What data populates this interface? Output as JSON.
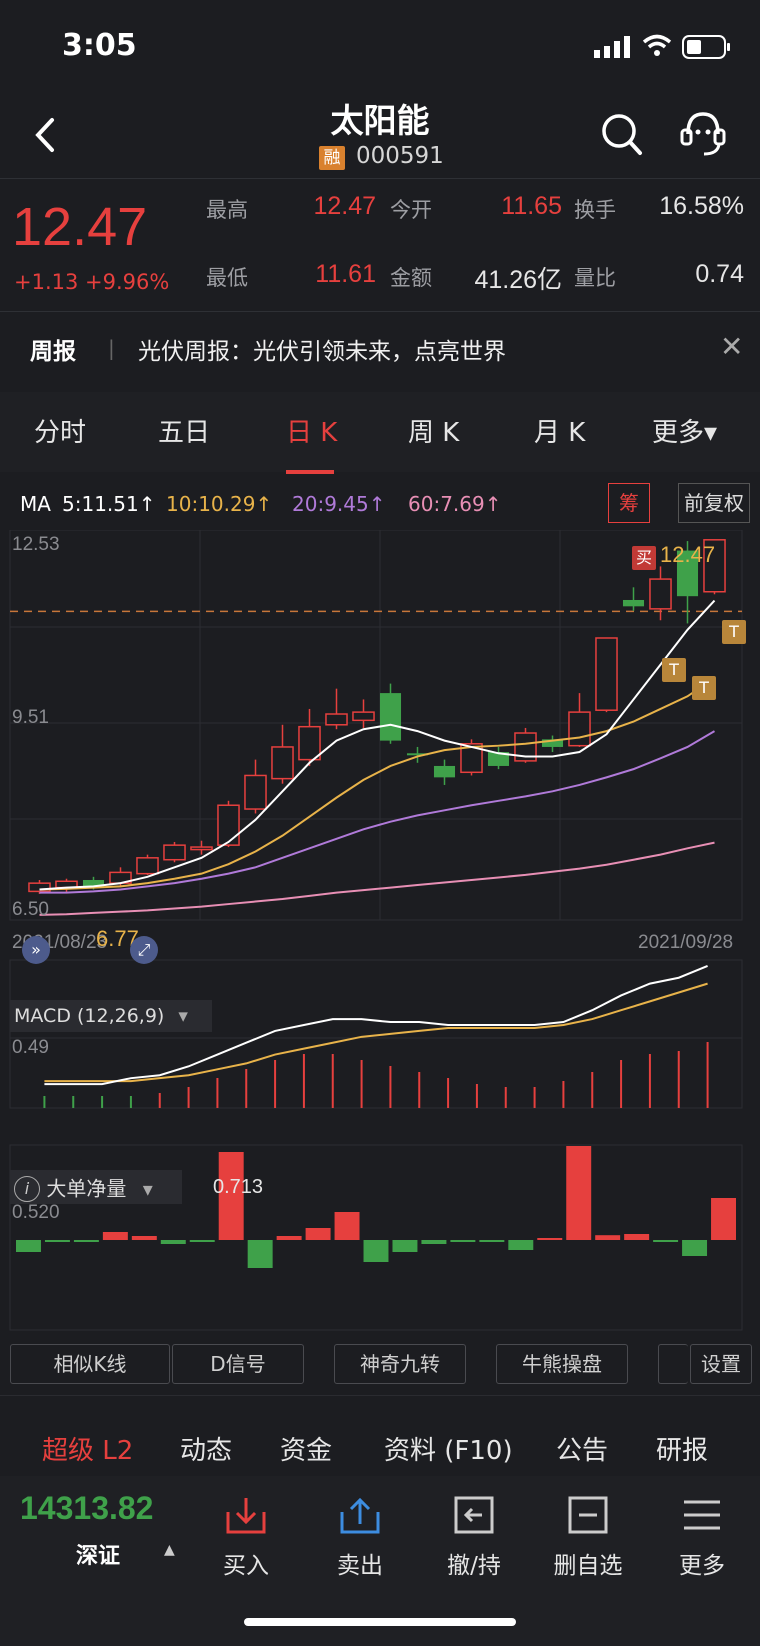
{
  "status_bar": {
    "time": "3:05"
  },
  "header": {
    "title": "太阳能",
    "badge": "融",
    "code": "000591"
  },
  "quote": {
    "price": "12.47",
    "change": "+1.13 +9.96%",
    "high_label": "最高",
    "high": "12.47",
    "open_label": "今开",
    "open": "11.65",
    "turnover_label": "换手",
    "turnover": "16.58%",
    "low_label": "最低",
    "low": "11.61",
    "amount_label": "金额",
    "amount": "41.26亿",
    "volume_ratio_label": "量比",
    "volume_ratio": "0.74"
  },
  "news": {
    "tag": "周报",
    "separator": "|",
    "text": "光伏周报：光伏引领未来，点亮世界",
    "close": "✕"
  },
  "chart_tabs": [
    "分时",
    "五日",
    "日 K",
    "周 K",
    "月 K",
    "更多▾"
  ],
  "ma": {
    "label": "MA",
    "ma5": "5:11.51↑",
    "ma10": "10:10.29↑",
    "ma20": "20:9.45↑",
    "ma60": "60:7.69↑"
  },
  "chart_buttons": {
    "chip": "筹",
    "adjust": "前复权"
  },
  "chart_labels": {
    "y_high": "12.53",
    "y_mid": "9.51",
    "y_low": "6.50",
    "date_start": "2021/08/23",
    "date_end": "2021/09/28",
    "buy_marker": "买",
    "last_marker": "12.47",
    "low_marker": "6.77",
    "t_marker": "T"
  },
  "macd": {
    "label": "MACD (12,26,9)",
    "caret": "▾",
    "y_label": "0.49"
  },
  "big_order": {
    "label": "大单净量",
    "caret": "▾",
    "value": "0.713",
    "y_label": "0.520"
  },
  "tools": [
    "相似K线",
    "D信号",
    "神奇九转",
    "牛熊操盘",
    "设置"
  ],
  "bottom_tabs": [
    "超级 L2",
    "动态",
    "资金",
    "资料 (F10)",
    "公告",
    "研报"
  ],
  "footer": {
    "index_value": "14313.82",
    "index_name": "深证",
    "caret": "▲",
    "buttons": [
      "买入",
      "卖出",
      "撤/持",
      "删自选",
      "更多"
    ]
  },
  "colors": {
    "up": "#e6403e",
    "down": "#3fa14a",
    "ma5": "#ffffff",
    "ma10": "#e8b34a",
    "ma20": "#b07ad9",
    "ma60": "#e88fb5"
  },
  "chart_data": {
    "type": "candlestick",
    "x": [
      "2021/08/23",
      "2021/09/28"
    ],
    "ylim": [
      6.5,
      12.53
    ],
    "candles": [
      {
        "o": 6.92,
        "c": 7.05,
        "h": 7.1,
        "l": 6.88,
        "up": true
      },
      {
        "o": 6.98,
        "c": 7.08,
        "h": 7.12,
        "l": 6.9,
        "up": true
      },
      {
        "o": 7.1,
        "c": 6.98,
        "h": 7.15,
        "l": 6.95,
        "up": false
      },
      {
        "o": 7.05,
        "c": 7.22,
        "h": 7.3,
        "l": 7.0,
        "up": true
      },
      {
        "o": 7.2,
        "c": 7.45,
        "h": 7.5,
        "l": 7.18,
        "up": true
      },
      {
        "o": 7.42,
        "c": 7.65,
        "h": 7.7,
        "l": 7.38,
        "up": true
      },
      {
        "o": 7.58,
        "c": 7.62,
        "h": 7.72,
        "l": 7.5,
        "up": true
      },
      {
        "o": 7.65,
        "c": 8.28,
        "h": 8.35,
        "l": 7.62,
        "up": true
      },
      {
        "o": 8.22,
        "c": 8.75,
        "h": 9.0,
        "l": 8.15,
        "up": true
      },
      {
        "o": 8.7,
        "c": 9.2,
        "h": 9.55,
        "l": 8.62,
        "up": true
      },
      {
        "o": 9.0,
        "c": 9.52,
        "h": 9.8,
        "l": 8.9,
        "up": true
      },
      {
        "o": 9.55,
        "c": 9.72,
        "h": 10.12,
        "l": 9.48,
        "up": true
      },
      {
        "o": 9.62,
        "c": 9.75,
        "h": 9.95,
        "l": 9.5,
        "up": true
      },
      {
        "o": 10.05,
        "c": 9.3,
        "h": 10.2,
        "l": 9.25,
        "up": false
      },
      {
        "o": 9.1,
        "c": 9.08,
        "h": 9.2,
        "l": 8.95,
        "up": false
      },
      {
        "o": 8.9,
        "c": 8.72,
        "h": 9.0,
        "l": 8.6,
        "up": false
      },
      {
        "o": 8.8,
        "c": 9.25,
        "h": 9.32,
        "l": 8.75,
        "up": true
      },
      {
        "o": 9.12,
        "c": 8.9,
        "h": 9.2,
        "l": 8.85,
        "up": false
      },
      {
        "o": 8.98,
        "c": 9.42,
        "h": 9.5,
        "l": 8.95,
        "up": true
      },
      {
        "o": 9.32,
        "c": 9.2,
        "h": 9.38,
        "l": 9.12,
        "up": false
      },
      {
        "o": 9.22,
        "c": 9.75,
        "h": 10.05,
        "l": 9.2,
        "up": true
      },
      {
        "o": 9.78,
        "c": 10.92,
        "h": 10.92,
        "l": 9.75,
        "up": true
      },
      {
        "o": 11.52,
        "c": 11.42,
        "h": 11.72,
        "l": 11.35,
        "up": false
      },
      {
        "o": 11.38,
        "c": 11.85,
        "h": 12.05,
        "l": 11.2,
        "up": true
      },
      {
        "o": 11.58,
        "c": 12.3,
        "h": 12.45,
        "l": 11.15,
        "up": false
      },
      {
        "o": 11.65,
        "c": 12.47,
        "h": 12.47,
        "l": 11.61,
        "up": true
      }
    ],
    "ma5": [
      6.95,
      6.98,
      7.0,
      7.05,
      7.15,
      7.3,
      7.45,
      7.7,
      8.05,
      8.5,
      8.95,
      9.3,
      9.48,
      9.55,
      9.45,
      9.3,
      9.2,
      9.1,
      9.05,
      9.05,
      9.12,
      9.4,
      9.95,
      10.5,
      11.05,
      11.51
    ],
    "ma10": [
      6.95,
      6.96,
      6.98,
      7.0,
      7.05,
      7.12,
      7.2,
      7.35,
      7.55,
      7.8,
      8.1,
      8.4,
      8.68,
      8.9,
      9.05,
      9.15,
      9.2,
      9.22,
      9.25,
      9.3,
      9.35,
      9.45,
      9.6,
      9.8,
      10.0,
      10.29
    ],
    "ma20": [
      6.9,
      6.9,
      6.92,
      6.95,
      7.0,
      7.05,
      7.12,
      7.2,
      7.3,
      7.45,
      7.6,
      7.75,
      7.9,
      8.02,
      8.12,
      8.2,
      8.28,
      8.35,
      8.42,
      8.5,
      8.6,
      8.72,
      8.85,
      9.02,
      9.2,
      9.45
    ],
    "ma60": [
      6.55,
      6.56,
      6.58,
      6.6,
      6.62,
      6.65,
      6.68,
      6.72,
      6.76,
      6.8,
      6.85,
      6.9,
      6.94,
      6.98,
      7.02,
      7.06,
      7.1,
      7.14,
      7.18,
      7.23,
      7.28,
      7.34,
      7.42,
      7.5,
      7.6,
      7.69
    ],
    "macd_dif": [
      0.3,
      0.3,
      0.3,
      0.32,
      0.33,
      0.36,
      0.4,
      0.44,
      0.48,
      0.5,
      0.52,
      0.52,
      0.51,
      0.51,
      0.5,
      0.5,
      0.5,
      0.5,
      0.51,
      0.55,
      0.6,
      0.64,
      0.66,
      0.7
    ],
    "macd_dea": [
      0.31,
      0.31,
      0.31,
      0.31,
      0.32,
      0.33,
      0.35,
      0.37,
      0.4,
      0.42,
      0.44,
      0.46,
      0.47,
      0.48,
      0.49,
      0.49,
      0.49,
      0.49,
      0.5,
      0.52,
      0.55,
      0.58,
      0.61,
      0.64
    ],
    "macd_hist": [
      0.02,
      0.02,
      0.02,
      0.02,
      0.03,
      0.05,
      0.08,
      0.11,
      0.14,
      0.16,
      0.16,
      0.14,
      0.12,
      0.1,
      0.08,
      0.06,
      0.05,
      0.05,
      0.07,
      0.1,
      0.14,
      0.16,
      0.17,
      0.2
    ],
    "big_order": [
      -0.3,
      -0.05,
      -0.02,
      0.2,
      0.1,
      -0.1,
      -0.02,
      2.2,
      -0.7,
      0.1,
      0.3,
      0.7,
      -0.55,
      -0.3,
      -0.1,
      -0.05,
      -0.03,
      -0.25,
      0.0,
      2.35,
      0.12,
      0.15,
      -0.02,
      -0.4,
      1.05
    ]
  }
}
